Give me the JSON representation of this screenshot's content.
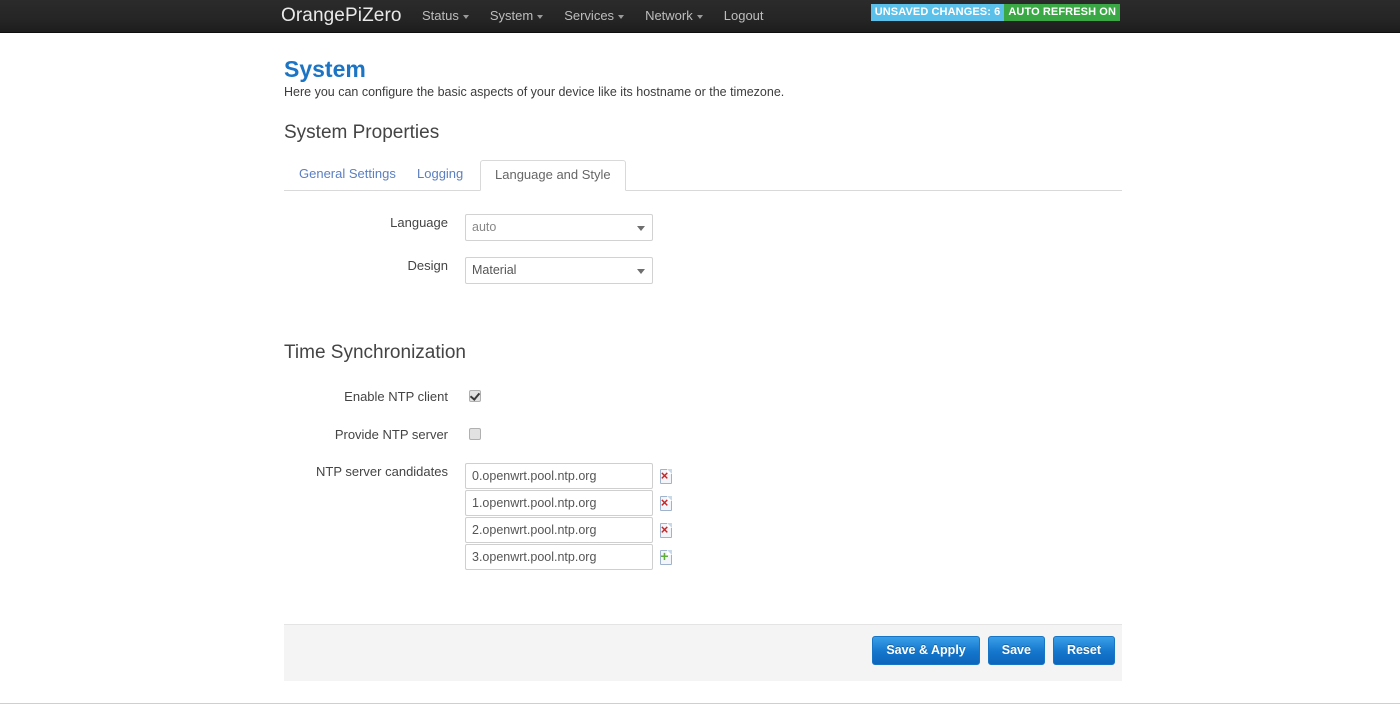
{
  "navbar": {
    "brand": "OrangePiZero",
    "items": [
      {
        "label": "Status",
        "has_caret": true
      },
      {
        "label": "System",
        "has_caret": true
      },
      {
        "label": "Services",
        "has_caret": true
      },
      {
        "label": "Network",
        "has_caret": true
      },
      {
        "label": "Logout",
        "has_caret": false
      }
    ],
    "badges": {
      "unsaved": "UNSAVED CHANGES: 6",
      "unsaved_color": "#5bc0ea",
      "refresh": "AUTO REFRESH ON",
      "refresh_color": "#3aa945"
    }
  },
  "page": {
    "title": "System",
    "title_color": "#1b74c4",
    "description": "Here you can configure the basic aspects of your device like its hostname or the timezone.",
    "sections": {
      "properties_title": "System Properties",
      "time_title": "Time Synchronization"
    }
  },
  "tabs": [
    {
      "label": "General Settings",
      "active": false
    },
    {
      "label": "Logging",
      "active": false
    },
    {
      "label": "Language and Style",
      "active": true
    }
  ],
  "language_style": {
    "language": {
      "label": "Language",
      "value": "auto"
    },
    "design": {
      "label": "Design",
      "value": "Material"
    }
  },
  "time_sync": {
    "enable_ntp_client": {
      "label": "Enable NTP client",
      "checked": true
    },
    "provide_ntp_server": {
      "label": "Provide NTP server",
      "checked": false
    },
    "ntp_candidates": {
      "label": "NTP server candidates",
      "values": [
        "0.openwrt.pool.ntp.org",
        "1.openwrt.pool.ntp.org",
        "2.openwrt.pool.ntp.org",
        "3.openwrt.pool.ntp.org"
      ],
      "row_actions": [
        "remove",
        "remove",
        "remove",
        "add"
      ],
      "remove_glyph": "×",
      "add_glyph": "+"
    }
  },
  "footer": {
    "save_apply_label": "Save & Apply",
    "save_label": "Save",
    "reset_label": "Reset"
  }
}
